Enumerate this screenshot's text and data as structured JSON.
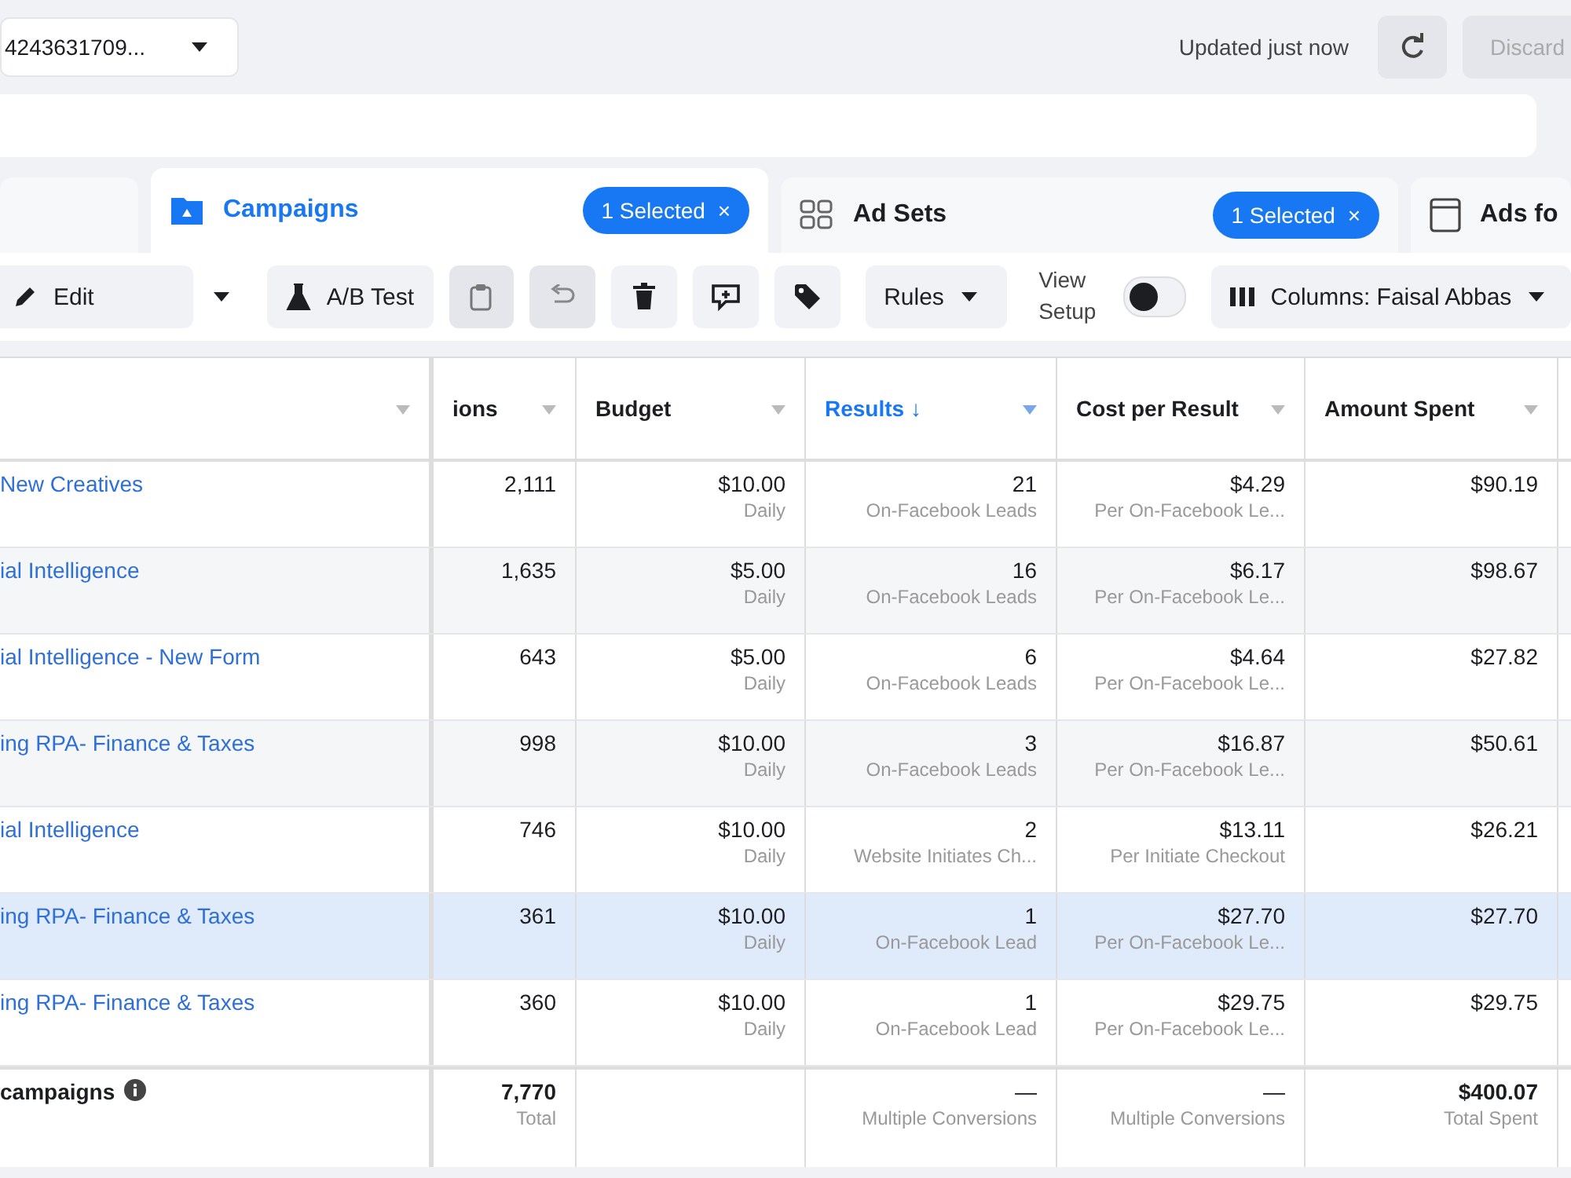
{
  "top_bar": {
    "account": "4243631709...",
    "status": "Updated just now",
    "discard_button": {
      "label": "Discard",
      "disabled": true
    }
  },
  "tabs": [
    {
      "kind": "blank",
      "selected": false
    },
    {
      "kind": "campaigns",
      "label": "Campaigns",
      "badge": "1 Selected",
      "badge_close": "×",
      "selected": true
    },
    {
      "kind": "adsets",
      "label": "Ad Sets",
      "badge": "1 Selected",
      "badge_close": "×",
      "selected": false
    },
    {
      "kind": "ads",
      "label": "Ads fo",
      "selected": false
    }
  ],
  "toolbar": [
    {
      "kind": "edit",
      "label": "Edit",
      "disabled": false
    },
    {
      "kind": "caret",
      "disabled": false
    },
    {
      "kind": "abtest",
      "label": "A/B Test",
      "disabled": false
    },
    {
      "kind": "duplicate",
      "disabled": true
    },
    {
      "kind": "undo",
      "disabled": true
    },
    {
      "kind": "delete",
      "disabled": false
    },
    {
      "kind": "compare",
      "disabled": false
    },
    {
      "kind": "tag",
      "disabled": false
    },
    {
      "kind": "rules",
      "label": "Rules",
      "disabled": false
    }
  ],
  "view_setup": {
    "label": "View Setup",
    "on": false
  },
  "columns_button": {
    "label": "Columns: Faisal Abbas"
  },
  "table": {
    "columns": [
      {
        "sorted": false
      },
      {
        "label": "ions",
        "sorted": false
      },
      {
        "label": "Budget",
        "sorted": false
      },
      {
        "label": "Results ↓",
        "sorted": true
      },
      {
        "label": "Cost per Result",
        "sorted": false
      },
      {
        "label": "Amount Spent",
        "sorted": false
      }
    ],
    "rows": [
      {
        "name": "New Creatives",
        "column_2": "2,111",
        "budget": "$10.00",
        "budget_note": "Daily",
        "results": "21",
        "results_note": "On-Facebook Leads",
        "cost": "$4.29",
        "cost_note": "Per On-Facebook Le...",
        "spent": "$90.19",
        "selected": false
      },
      {
        "name": "ial Intelligence",
        "column_2": "1,635",
        "budget": "$5.00",
        "budget_note": "Daily",
        "results": "16",
        "results_note": "On-Facebook Leads",
        "cost": "$6.17",
        "cost_note": "Per On-Facebook Le...",
        "spent": "$98.67",
        "selected": false
      },
      {
        "name": "ial Intelligence - New Form",
        "column_2": "643",
        "budget": "$5.00",
        "budget_note": "Daily",
        "results": "6",
        "results_note": "On-Facebook Leads",
        "cost": "$4.64",
        "cost_note": "Per On-Facebook Le...",
        "spent": "$27.82",
        "selected": false
      },
      {
        "name": "ing RPA- Finance & Taxes",
        "column_2": "998",
        "budget": "$10.00",
        "budget_note": "Daily",
        "results": "3",
        "results_note": "On-Facebook Leads",
        "cost": "$16.87",
        "cost_note": "Per On-Facebook Le...",
        "spent": "$50.61",
        "selected": false
      },
      {
        "name": "ial Intelligence",
        "column_2": "746",
        "budget": "$10.00",
        "budget_note": "Daily",
        "results": "2",
        "results_note": "Website Initiates Ch...",
        "cost": "$13.11",
        "cost_note": "Per Initiate Checkout",
        "spent": "$26.21",
        "selected": false
      },
      {
        "name": "ing RPA- Finance & Taxes",
        "column_2": "361",
        "budget": "$10.00",
        "budget_note": "Daily",
        "results": "1",
        "results_note": "On-Facebook Lead",
        "cost": "$27.70",
        "cost_note": "Per On-Facebook Le...",
        "spent": "$27.70",
        "selected": true
      },
      {
        "name": "ing RPA- Finance & Taxes",
        "column_2": "360",
        "budget": "$10.00",
        "budget_note": "Daily",
        "results": "1",
        "results_note": "On-Facebook Lead",
        "cost": "$29.75",
        "cost_note": "Per On-Facebook Le...",
        "spent": "$29.75",
        "selected": false
      }
    ],
    "footer": {
      "label": "campaigns",
      "column_2": "7,770",
      "column_2_note": "Total",
      "results": "—",
      "results_note": "Multiple Conversions",
      "cost": "—",
      "cost_note": "Multiple Conversions",
      "spent": "$400.07",
      "spent_note": "Total Spent"
    }
  }
}
